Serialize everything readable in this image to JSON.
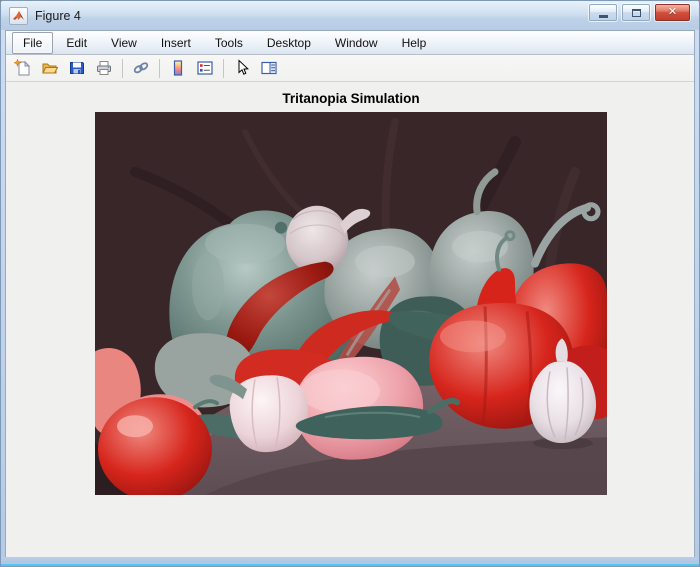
{
  "window": {
    "title": "Figure 4",
    "app_icon": "matlab-logo-icon",
    "controls": {
      "minimize": "minimize",
      "maximize": "maximize",
      "close": "close"
    }
  },
  "menu": {
    "items": [
      "File",
      "Edit",
      "View",
      "Insert",
      "Tools",
      "Desktop",
      "Window",
      "Help"
    ]
  },
  "toolbar": {
    "buttons": [
      "new-figure",
      "open-file",
      "save-figure",
      "print-figure",
      "link-plot",
      "insert-colorbar",
      "insert-legend",
      "edit-plot",
      "show-plot-tools"
    ]
  },
  "figure": {
    "title": "Tritanopia Simulation",
    "image": {
      "subject": "peppers-still-life-tritanopia",
      "palette": {
        "backdrop": "#382629",
        "tablecloth": "#6e5c62",
        "teal_pepper": "#7d958f",
        "gray_pepper": "#9aa5a2",
        "red_pepper": "#d6251c",
        "dark_red_chili": "#9c1a12",
        "pink_pepper": "#efa3ab",
        "white_pepper": "#ecd4d9",
        "onion": "#d5c9cd",
        "garlic": "#e8e0e4",
        "teal_chili": "#3f635c"
      }
    }
  },
  "colors": {
    "frame": "#b4cae5",
    "frame_accent": "#52c6ef",
    "canvas": "#f0f0ee",
    "close_button": "#d1503c",
    "titlebar_text": "#1b1b1b"
  }
}
